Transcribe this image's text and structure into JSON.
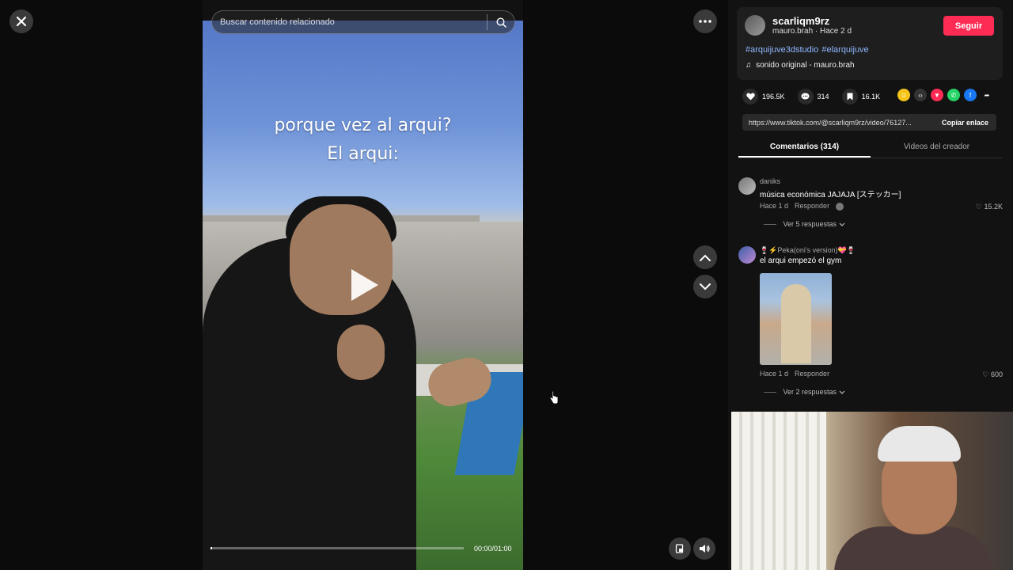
{
  "search": {
    "placeholder": "Buscar contenido relacionado"
  },
  "video": {
    "overlay_line1": "porque vez al arqui?",
    "overlay_line2": "El arqui:",
    "time": "00:00/01:00",
    "progress_fraction": 0.0
  },
  "creator": {
    "username": "scarliqm9rz",
    "subline": "mauro.brah · Hace 2 d",
    "follow_label": "Seguir",
    "hashtags": [
      "#arquijuve3dstudio",
      "#elarquijuve"
    ],
    "sound": "sonido original - mauro.brah"
  },
  "stats": {
    "likes": "196.5K",
    "comments": "314",
    "saves": "16.1K"
  },
  "share": {
    "url": "https://www.tiktok.com/@scarliqm9rz/video/76127...",
    "copy_label": "Copiar enlace",
    "icons": [
      "friends-icon",
      "embed-icon",
      "send-icon",
      "whatsapp-icon",
      "facebook-icon",
      "share-arrow-icon"
    ],
    "colors": [
      "#f7c51a",
      "#333333",
      "#fe2c55",
      "#25d366",
      "#1877f2",
      "#121212"
    ]
  },
  "tabs": {
    "comments": "Comentarios (314)",
    "creator_videos": "Videos del creador"
  },
  "comments": [
    {
      "user": "daniks",
      "text": "música económica JAJAJA [ステッカー]",
      "time": "Hace 1 d",
      "reply": "Responder",
      "likes": "15.2K",
      "replies": "Ver 5 respuestas"
    },
    {
      "user": "🍷⚡Peka(oni's version)💝🍷",
      "text": "el arqui empezó el gym",
      "time": "Hace 1 d",
      "reply": "Responder",
      "likes": "600",
      "replies": "Ver 2 respuestas"
    }
  ]
}
